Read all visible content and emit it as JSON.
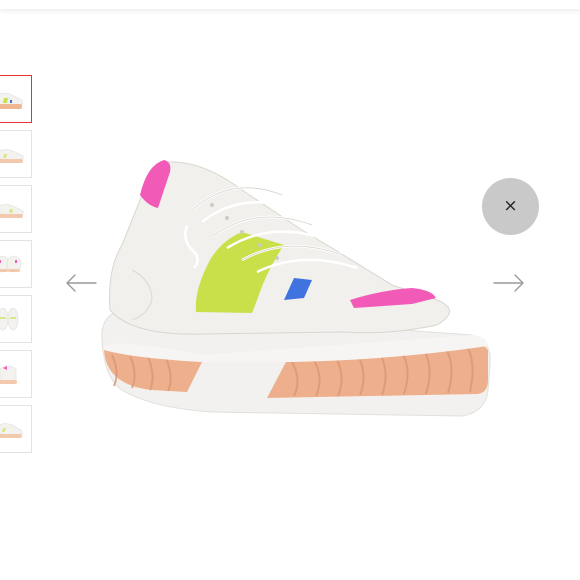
{
  "gallery": {
    "thumbnails": [
      {
        "view": "side-profile",
        "selected": true
      },
      {
        "view": "outer-side",
        "selected": false
      },
      {
        "view": "inner-side",
        "selected": false
      },
      {
        "view": "front-pair",
        "selected": false
      },
      {
        "view": "top-pair",
        "selected": false
      },
      {
        "view": "back",
        "selected": false
      },
      {
        "view": "three-quarter",
        "selected": false
      }
    ],
    "close_symbol": "×",
    "prev_icon": "arrow-left-icon",
    "next_icon": "arrow-right-icon"
  },
  "colors": {
    "selected_border": "#e8303a",
    "close_bg": "#c9c9c9",
    "sole": "#f0b892",
    "accent_pink": "#f25ab8",
    "accent_lime": "#c9e04a",
    "accent_blue": "#3f73e0"
  }
}
